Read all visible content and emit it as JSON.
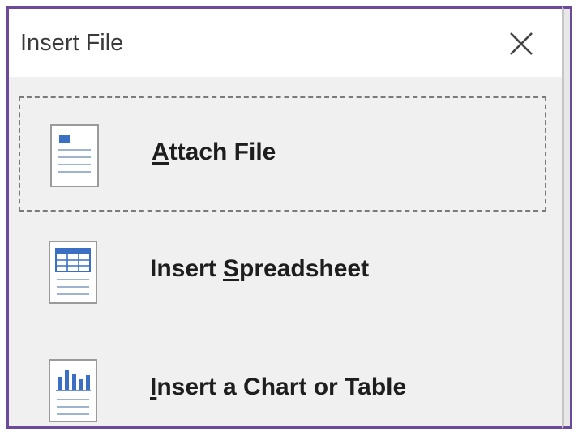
{
  "dialog": {
    "title": "Insert File",
    "close_icon": "close-icon"
  },
  "options": [
    {
      "label_pre": "",
      "mnemonic": "A",
      "label_post": "ttach File",
      "icon": "document-icon",
      "focused": true
    },
    {
      "label_pre": "Insert ",
      "mnemonic": "S",
      "label_post": "preadsheet",
      "icon": "spreadsheet-document-icon",
      "focused": false
    },
    {
      "label_pre": "",
      "mnemonic": "I",
      "label_post": "nsert a Chart or Table",
      "icon": "chart-document-icon",
      "focused": false
    }
  ],
  "colors": {
    "frame": "#6b4a9b",
    "icon_accent": "#3a6fc4",
    "dialog_bg": "#f0f0f0",
    "header_bg": "#ffffff"
  }
}
